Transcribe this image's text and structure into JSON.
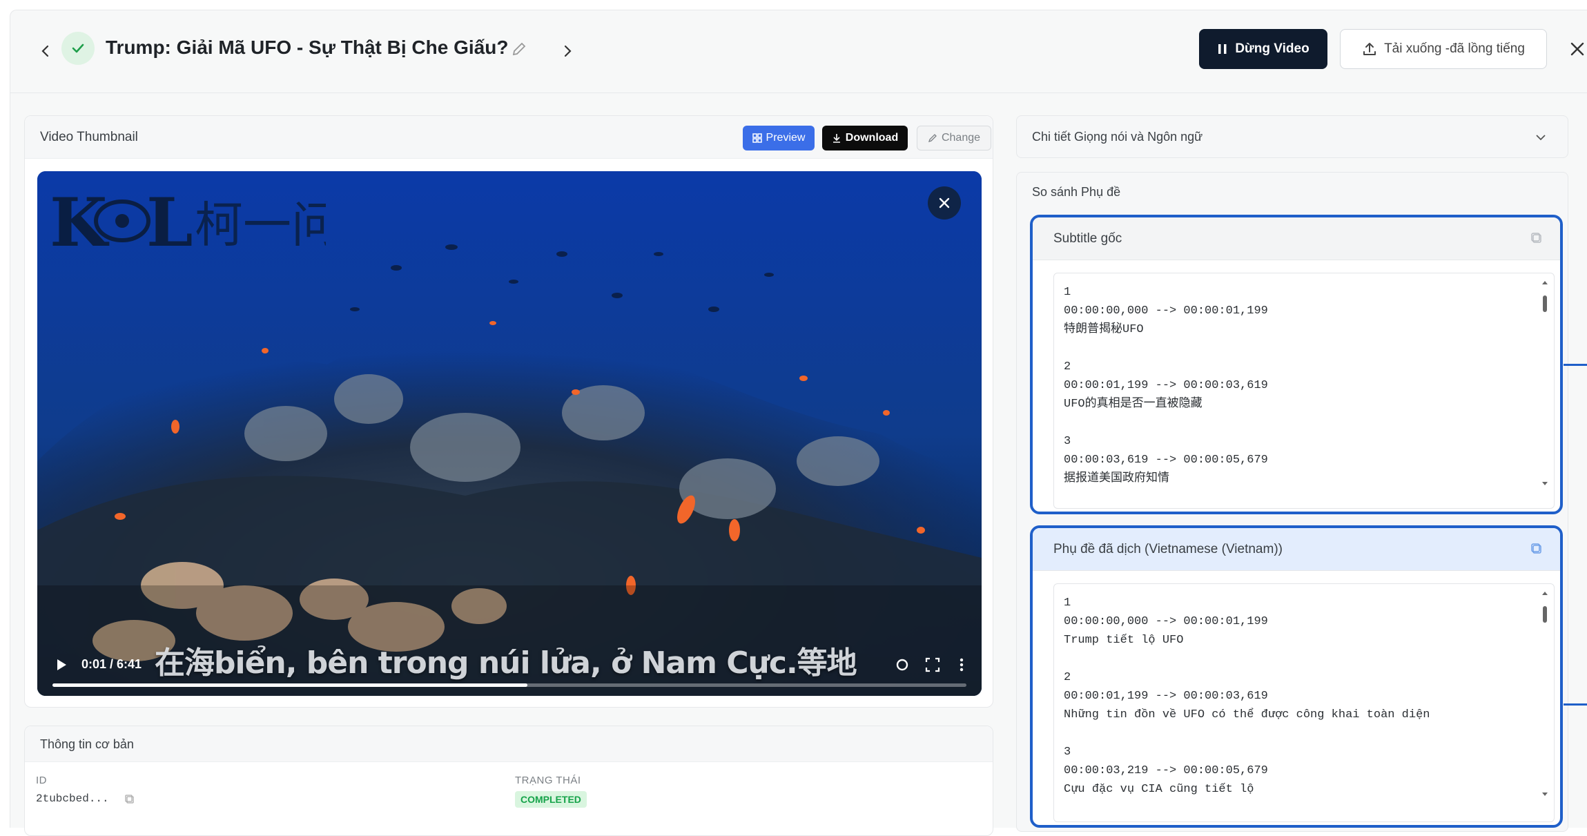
{
  "header": {
    "title": "Trump: Giải Mã UFO - Sự Thật Bị Che Giấu?",
    "stop_button": "Dừng Video",
    "download_button": "Tải xuống -đã lồng tiếng"
  },
  "thumbnail_card": {
    "label": "Video Thumbnail",
    "preview": "Preview",
    "download": "Download",
    "change": "Change"
  },
  "video": {
    "logo_text": "柯一问",
    "caption": "在海biển, bên trong núi lửa, ở Nam Cực.等地",
    "time": "0:01 / 6:41",
    "progress": 0.52
  },
  "info_card": {
    "label": "Thông tin cơ bản",
    "id_label": "ID",
    "id_value": "2tubcbed...",
    "status_label": "TRẠNG THÁI",
    "status_value": "COMPLETED"
  },
  "right": {
    "voice_bar": "Chi tiết Giọng nói và Ngôn ngữ",
    "compare_label": "So sánh Phụ đề",
    "original": {
      "label": "Subtitle gốc",
      "lines": "1\n00:00:00,000 --> 00:00:01,199\n特朗普揭秘UFO\n\n2\n00:00:01,199 --> 00:00:03,619\nUFO的真相是否一直被隐藏\n\n3\n00:00:03,619 --> 00:00:05,679\n据报道美国政府知情"
    },
    "translated": {
      "label": "Phụ đề đã dịch (Vietnamese (Vietnam))",
      "lines": "1\n00:00:00,000 --> 00:00:01,199\nTrump tiết lộ UFO\n\n2\n00:00:01,199 --> 00:00:03,619\nNhững tin đồn về UFO có thể được công khai toàn diện\n\n3\n00:00:03,219 --> 00:00:05,679\nCựu đặc vụ CIA cũng tiết lộ"
    }
  },
  "colors": {
    "accent": "#1f5fc9",
    "dark_button": "#0f1b2d",
    "success": "#16a34a"
  }
}
